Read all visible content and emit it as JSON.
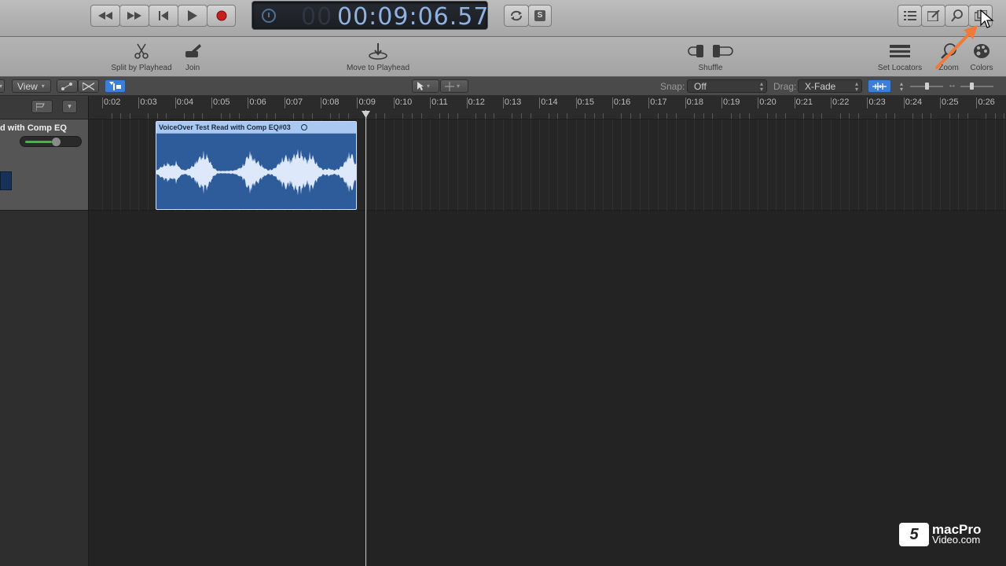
{
  "transport": {
    "timecode_dim": "00",
    "timecode": "00:09:06.57",
    "buttons": [
      "rewind",
      "fast-forward",
      "go-to-beginning",
      "play",
      "record"
    ],
    "solo_label": "S"
  },
  "toolbar": {
    "split_label": "Split by Playhead",
    "join_label": "Join",
    "move_label": "Move to Playhead",
    "shuffle_label": "Shuffle",
    "set_locators_label": "Set Locators",
    "zoom_label": "Zoom",
    "colors_label": "Colors"
  },
  "secbar": {
    "view_label": "View",
    "snap_label": "Snap:",
    "snap_value": "Off",
    "drag_label": "Drag:",
    "drag_value": "X-Fade"
  },
  "ruler": {
    "ticks": [
      "0:02",
      "0:03",
      "0:04",
      "0:05",
      "0:06",
      "0:07",
      "0:08",
      "0:09",
      "0:10",
      "0:11",
      "0:12",
      "0:13",
      "0:14",
      "0:15",
      "0:16",
      "0:17",
      "0:18",
      "0:19",
      "0:20",
      "0:21",
      "0:22",
      "0:23",
      "0:24",
      "0:25",
      "0:26"
    ]
  },
  "track": {
    "name": "d with Comp EQ",
    "volume_level": 0.6
  },
  "region": {
    "title": "VoiceOver Test Read with Comp EQ#03"
  },
  "watermark": {
    "line1": "macPro",
    "line2": "Video.com"
  },
  "colors": {
    "region_fill": "#2e5c9a",
    "region_header": "#a9c9f3",
    "lcd_text": "#8fb2e0",
    "accent_arrow": "#f07a3a",
    "volume_green": "#3cbb3c"
  }
}
